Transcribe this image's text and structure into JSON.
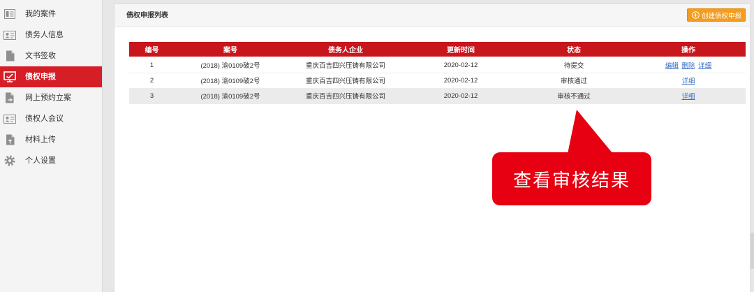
{
  "sidebar": {
    "items": [
      {
        "label": "我的案件",
        "icon": "list-box-icon",
        "active": false
      },
      {
        "label": "债务人信息",
        "icon": "id-card-icon",
        "active": false
      },
      {
        "label": "文书签收",
        "icon": "document-icon",
        "active": false
      },
      {
        "label": "债权申报",
        "icon": "monitor-icon",
        "active": true
      },
      {
        "label": "网上预约立案",
        "icon": "document-arrow-icon",
        "active": false
      },
      {
        "label": "债权人会议",
        "icon": "id-card-icon",
        "active": false
      },
      {
        "label": "材料上传",
        "icon": "document-upload-icon",
        "active": false
      },
      {
        "label": "个人设置",
        "icon": "gear-icon",
        "active": false
      }
    ]
  },
  "panel": {
    "title": "债权申报列表",
    "create_button": {
      "label": "创建债权申报",
      "icon": "plus-circle-icon"
    }
  },
  "table": {
    "columns": [
      "编号",
      "案号",
      "债务人企业",
      "更新时间",
      "状态",
      "操作"
    ],
    "rows": [
      {
        "number": "1",
        "case_no": "(2018) 渝0109破2号",
        "debtor": "重庆百吉四兴压铸有限公司",
        "updated": "2020-02-12",
        "status": "待提交",
        "actions": [
          "编辑",
          "删除",
          "详细"
        ],
        "highlighted": false
      },
      {
        "number": "2",
        "case_no": "(2018) 渝0109破2号",
        "debtor": "重庆百吉四兴压铸有限公司",
        "updated": "2020-02-12",
        "status": "审核通过",
        "actions": [
          "详细"
        ],
        "highlighted": false
      },
      {
        "number": "3",
        "case_no": "(2018) 渝0109破2号",
        "debtor": "重庆百吉四兴压铸有限公司",
        "updated": "2020-02-12",
        "status": "审核不通过",
        "actions": [
          "详细"
        ],
        "highlighted": true
      }
    ]
  },
  "callout": {
    "text": "查看审核结果"
  },
  "colors": {
    "active_red": "#d61e27",
    "table_header_red": "#c8161d",
    "callout_red": "#e60012",
    "button_orange": "#f39c1f",
    "link_blue": "#3a70c6"
  }
}
